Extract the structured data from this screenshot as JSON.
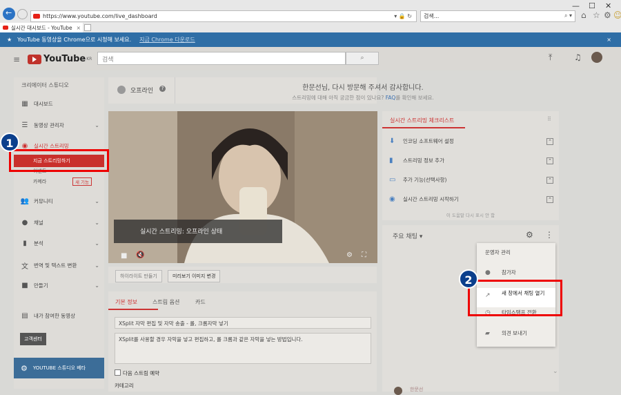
{
  "browser": {
    "url": "https://www.youtube.com/live_dashboard",
    "search_placeholder": "검색...",
    "tab_title": "실시간 대시보드 - YouTube",
    "tab_close": "×"
  },
  "banner": {
    "text": "YouTube 동영상을 Chrome으로 시청해 보세요.",
    "link": "지금 Chrome 다운로드",
    "close": "×"
  },
  "masthead": {
    "logo": "YouTube",
    "region": "KR",
    "search_placeholder": "검색"
  },
  "sidebar": {
    "title": "크리에이터 스튜디오",
    "items": [
      {
        "label": "대시보드"
      },
      {
        "label": "동영상 관리자"
      },
      {
        "label": "실시간 스트리밍"
      },
      {
        "label": "지금 스트리밍하기"
      },
      {
        "label": "이벤트"
      },
      {
        "label": "카메라",
        "badge": "새 기능"
      },
      {
        "label": "커뮤니티"
      },
      {
        "label": "채널"
      },
      {
        "label": "분석"
      },
      {
        "label": "번역 및 텍스트 변환"
      },
      {
        "label": "만들기"
      },
      {
        "label": "내가 참여한 동영상"
      }
    ],
    "help_button": "고객센터",
    "studio_beta": "YOUTUBE 스튜디오 베타"
  },
  "status": {
    "label": "오프라인",
    "welcome": "한문선님, 다시 방문해 주셔서 감사합니다.",
    "faq_prefix": "스트리밍에 대해 아직 궁금한 점이 있나요?",
    "faq_link": "FAQ",
    "faq_suffix": "를 확인해 보세요."
  },
  "video": {
    "overlay": "실시간 스트리밍: 오프라인 상태"
  },
  "buttons": {
    "highlight": "하이라이트 만들기",
    "preview_change": "미리보기 이미지 변경"
  },
  "info_tabs": [
    "기본 정보",
    "스트림 옵션",
    "카드"
  ],
  "info": {
    "title_value": "XSplit 자막 편집 및 자막 송출 - 롤, 크롬자막 넣기",
    "desc_value": "XSplit를 사용할 경우 자막을 넣고 편집하고, 롤 크롬과 같은 자막을 넣는 방법입니다.",
    "schedule_label": "다음 스트림 예약",
    "category_label": "카테고리"
  },
  "checklist": {
    "title": "실시간 스트리밍 체크리스트",
    "items": [
      {
        "label": "인코딩 소프트웨어 설정"
      },
      {
        "label": "스트리밍 정보 추가"
      },
      {
        "label": "추가 기능(선택사항)"
      },
      {
        "label": "실시간 스트리밍 시작하기"
      }
    ],
    "footer": "이 도움말 다시 표시 안 함"
  },
  "chat": {
    "title": "주요 채팅",
    "menu": [
      {
        "label": "운영자 관리"
      },
      {
        "label": "참가자"
      },
      {
        "label": "새 창에서 채팅 열기"
      },
      {
        "label": "타임스탬프 전환"
      },
      {
        "label": "의견 보내기"
      }
    ],
    "footer_name": "한문선"
  },
  "callouts": [
    "1",
    "2"
  ]
}
